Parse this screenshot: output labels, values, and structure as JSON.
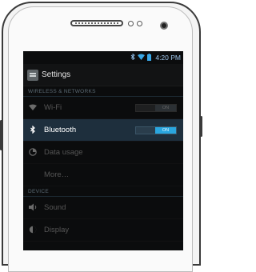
{
  "status_bar": {
    "time": "4:20 PM",
    "icons": [
      "bluetooth-icon",
      "wifi-icon",
      "battery-icon"
    ]
  },
  "action_bar": {
    "title": "Settings",
    "icon": "settings-icon"
  },
  "sections": {
    "wireless": "WIRELESS & NETWORKS",
    "device": "DEVICE"
  },
  "items": {
    "wifi": {
      "label": "Wi-Fi",
      "icon": "wifi-icon",
      "toggle": "ON"
    },
    "bluetooth": {
      "label": "Bluetooth",
      "icon": "bluetooth-icon",
      "toggle": "ON"
    },
    "data_usage": {
      "label": "Data usage",
      "icon": "pie-icon"
    },
    "more": {
      "label": "More…"
    },
    "sound": {
      "label": "Sound",
      "icon": "speaker-icon"
    },
    "display": {
      "label": "Display",
      "icon": "brightness-icon"
    }
  },
  "colors": {
    "accent": "#2aa6df",
    "highlight_row": "#1e2f3d",
    "screen_bg": "#0b0c0d"
  }
}
